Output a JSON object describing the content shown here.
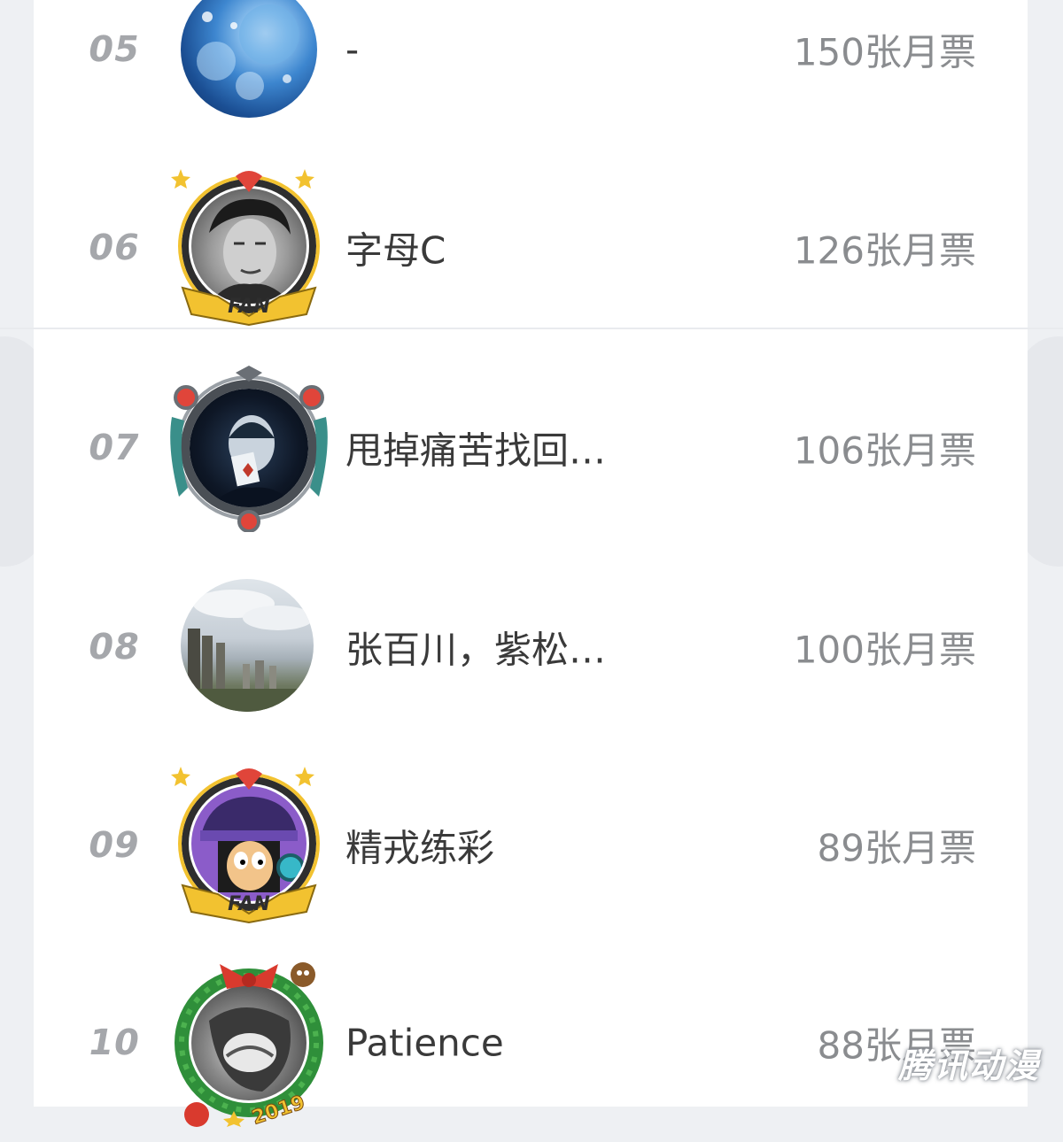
{
  "list": {
    "unit_suffix": "张月票",
    "rows": [
      {
        "rank": "05",
        "name": "-",
        "votes": "150张月票",
        "avatar": "planet-avatar",
        "frame": "none"
      },
      {
        "rank": "06",
        "name": "字母C",
        "votes": "126张月票",
        "avatar": "man-portrait-avatar",
        "frame": "fan-badge-frame"
      },
      {
        "rank": "07",
        "name": "甩掉痛苦找回…",
        "votes": "106张月票",
        "avatar": "joker-avatar",
        "frame": "mech-frame"
      },
      {
        "rank": "08",
        "name": "张百川，紫松…",
        "votes": "100张月票",
        "avatar": "city-skyline-avatar",
        "frame": "none"
      },
      {
        "rank": "09",
        "name": "精戎练彩",
        "votes": "89张月票",
        "avatar": "cartoon-avatar",
        "frame": "fan-badge-frame"
      },
      {
        "rank": "10",
        "name": "Patience",
        "votes": "88张月票",
        "avatar": "cat-avatar",
        "frame": "christmas-wreath-frame"
      }
    ]
  },
  "watermark": {
    "text": "腾讯动漫"
  },
  "colors": {
    "background": "#eef0f3",
    "card": "#ffffff",
    "rank_text": "#a5a7ab",
    "name_text": "#3a3a3a",
    "votes_text": "#8a8c8f",
    "fan_frame_gold": "#f2c230",
    "fan_frame_dark": "#2e2e2e",
    "fan_frame_red": "#e0453a"
  }
}
